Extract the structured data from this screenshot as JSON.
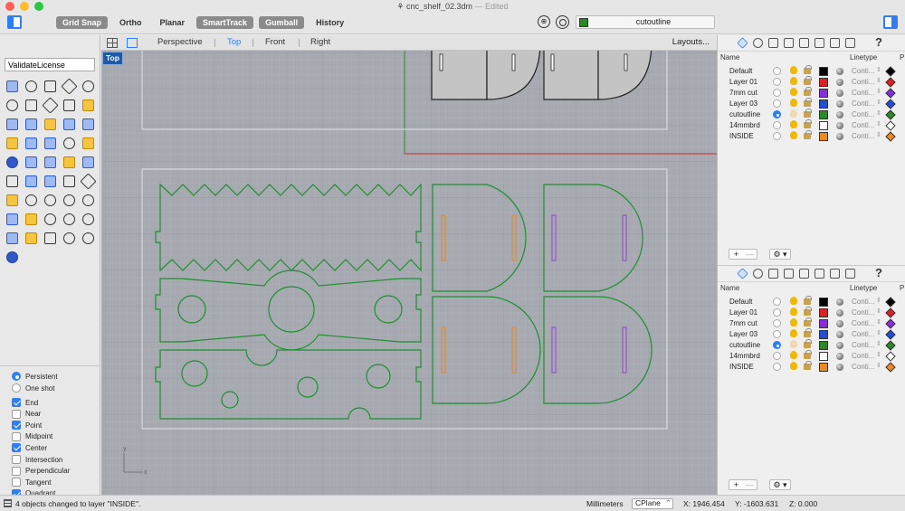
{
  "window": {
    "title": "cnc_shelf_02.3dm",
    "subtitle": "— Edited",
    "traffic_lights": [
      "#ff5f57",
      "#febc2e",
      "#28c840"
    ]
  },
  "toolbar": {
    "modes": [
      {
        "label": "Grid Snap",
        "on": true
      },
      {
        "label": "Ortho",
        "on": false
      },
      {
        "label": "Planar",
        "on": false
      },
      {
        "label": "SmartTrack",
        "on": true
      },
      {
        "label": "Gumball",
        "on": true
      },
      {
        "label": "History",
        "on": false
      }
    ],
    "current_layer": {
      "name": "cutoutline",
      "color": "#2a8a22"
    }
  },
  "command": {
    "value": "ValidateLicense"
  },
  "tools": [
    "select-point-icon",
    "point-icon",
    "polyline-icon",
    "curve-icon",
    "circle-icon",
    "ellipse-icon",
    "rectangle-icon",
    "arc-icon",
    "polygon-icon",
    "text-icon",
    "surface-icon",
    "loft-icon",
    "sweep-icon",
    "extrude-icon",
    "cylinder-icon",
    "box-icon",
    "fillet-icon",
    "blend-icon",
    "offset-icon",
    "trim-icon",
    "solid-icon",
    "boolean-icon",
    "join-icon",
    "explode-icon",
    "bend-icon",
    "array-icon",
    "split-icon",
    "rebuild-icon",
    "check-icon",
    "flow-icon",
    "transform-icon",
    "zoom-icon",
    "zoom-window-icon",
    "zoom-extents-icon",
    "zoom-selected-icon",
    "rotate-view-icon",
    "car-icon",
    "pan-icon",
    "dimension-icon",
    "light-icon",
    "render-icon",
    "annotation-icon",
    "mesh-icon",
    "group-icon",
    "block-icon",
    "sphere-icon"
  ],
  "osnap": {
    "modes": [
      {
        "label": "Persistent",
        "on": true
      },
      {
        "label": "One shot",
        "on": false
      }
    ],
    "snaps": [
      {
        "label": "End",
        "on": true
      },
      {
        "label": "Near",
        "on": false
      },
      {
        "label": "Point",
        "on": true
      },
      {
        "label": "Midpoint",
        "on": false
      },
      {
        "label": "Center",
        "on": true
      },
      {
        "label": "Intersection",
        "on": false
      },
      {
        "label": "Perpendicular",
        "on": false
      },
      {
        "label": "Tangent",
        "on": false
      },
      {
        "label": "Quadrant",
        "on": true
      }
    ]
  },
  "viewtabs": {
    "tabs": [
      "Perspective",
      "Top",
      "Front",
      "Right"
    ],
    "active": "Top",
    "layouts": "Layouts..."
  },
  "viewport": {
    "label": "Top",
    "axis_x": "x",
    "axis_y": "y",
    "colors": {
      "grid_minor": "#b4b8be",
      "grid_major": "#999da4",
      "cut": "#1e8f2e",
      "pocket": "#e08a3c",
      "drill": "#9a4fd0",
      "outline": "#dcdcdc",
      "red_axis": "#c83030"
    }
  },
  "layers": {
    "headers": {
      "name": "Name",
      "linetype": "Linetype",
      "print": "P"
    },
    "rows": [
      {
        "name": "Default",
        "color": "#000000",
        "current": false,
        "linetype": "Conti...",
        "pcolor": "#000000"
      },
      {
        "name": "Layer 01",
        "color": "#e02020",
        "current": false,
        "linetype": "Conti...",
        "pcolor": "#e02020"
      },
      {
        "name": "7mm cut",
        "color": "#8a2be2",
        "current": false,
        "linetype": "Conti...",
        "pcolor": "#8a2be2"
      },
      {
        "name": "Layer 03",
        "color": "#1f4ed8",
        "current": false,
        "linetype": "Conti...",
        "pcolor": "#1f4ed8"
      },
      {
        "name": "cutoutline",
        "color": "#2a8a22",
        "current": true,
        "linetype": "Conti...",
        "pcolor": "#2a8a22"
      },
      {
        "name": "14mmbrd",
        "color": "#ffffff",
        "current": false,
        "linetype": "Conti...",
        "pcolor": "#ffffff"
      },
      {
        "name": "INSIDE",
        "color": "#f08a1c",
        "current": false,
        "linetype": "Conti...",
        "pcolor": "#f08a1c"
      }
    ],
    "footer": {
      "add": "+",
      "remove": "—",
      "gear": "⚙ ▾"
    }
  },
  "status": {
    "message": "4 objects changed to layer \"INSIDE\".",
    "units": "Millimeters",
    "cplane": "CPlane",
    "x": "X: 1946.454",
    "y": "Y: -1603.631",
    "z": "Z: 0.000"
  }
}
